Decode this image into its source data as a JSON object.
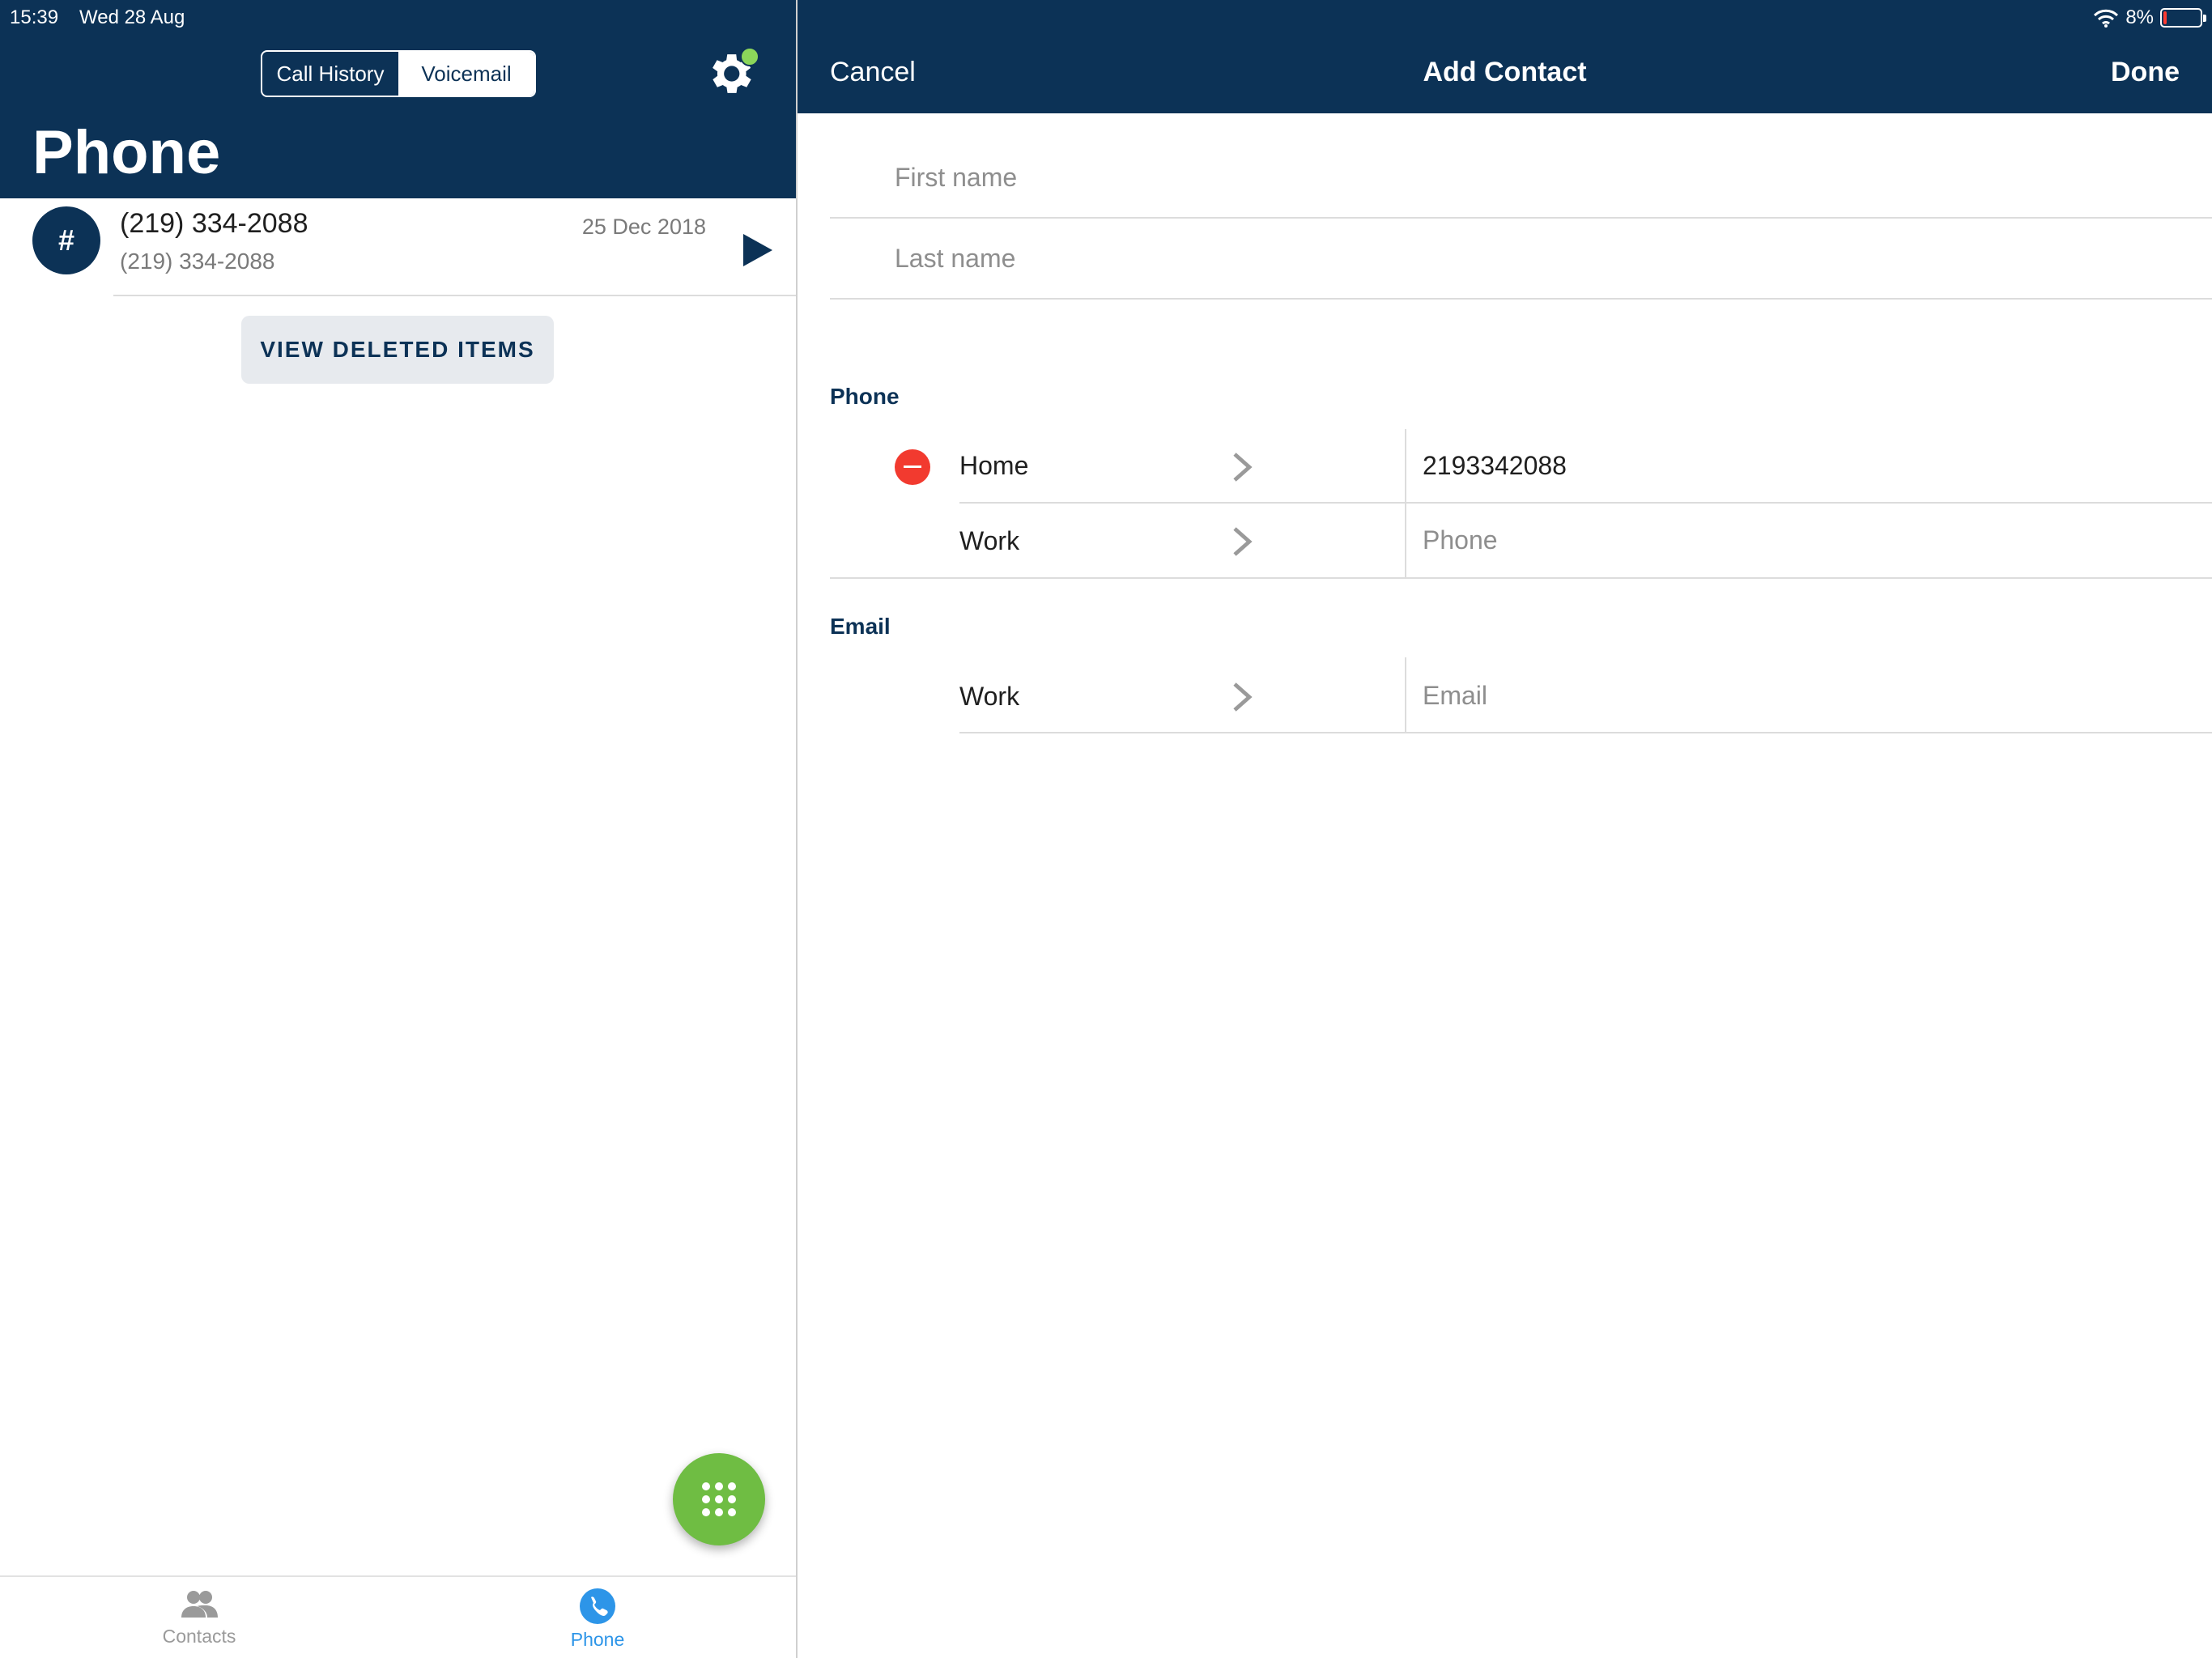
{
  "status_bar": {
    "time": "15:39",
    "date": "Wed 28 Aug",
    "battery_text": "8%",
    "battery_level": 0.08,
    "icons": [
      "wifi-icon",
      "battery-icon"
    ]
  },
  "left": {
    "segmented": {
      "call_history": "Call History",
      "voicemail": "Voicemail",
      "selected": "Voicemail"
    },
    "title": "Phone",
    "voicemail_row": {
      "avatar": "#",
      "title": "(219) 334-2088",
      "subtitle": "(219) 334-2088",
      "date": "25 Dec 2018"
    },
    "view_deleted_label": "VIEW DELETED ITEMS",
    "tabs": [
      {
        "label": "Contacts",
        "icon": "contacts-icon",
        "active": false
      },
      {
        "label": "Phone",
        "icon": "phone-icon",
        "active": true
      }
    ],
    "colors": {
      "header": "#0c3256",
      "fab": "#6fbd43",
      "notification_dot": "#8bd65a",
      "active_tab": "#2d95e8"
    }
  },
  "right": {
    "nav": {
      "cancel": "Cancel",
      "title": "Add Contact",
      "done": "Done"
    },
    "first_name_placeholder": "First name",
    "last_name_placeholder": "Last name",
    "phone_section": "Phone",
    "phone_rows": [
      {
        "label": "Home",
        "value": "2193342088",
        "placeholder": ""
      },
      {
        "label": "Work",
        "value": "",
        "placeholder": "Phone"
      }
    ],
    "email_section": "Email",
    "email_rows": [
      {
        "label": "Work",
        "value": "",
        "placeholder": "Email"
      }
    ],
    "colors": {
      "remove": "#f23a2f",
      "section_label": "#0c3256"
    }
  }
}
